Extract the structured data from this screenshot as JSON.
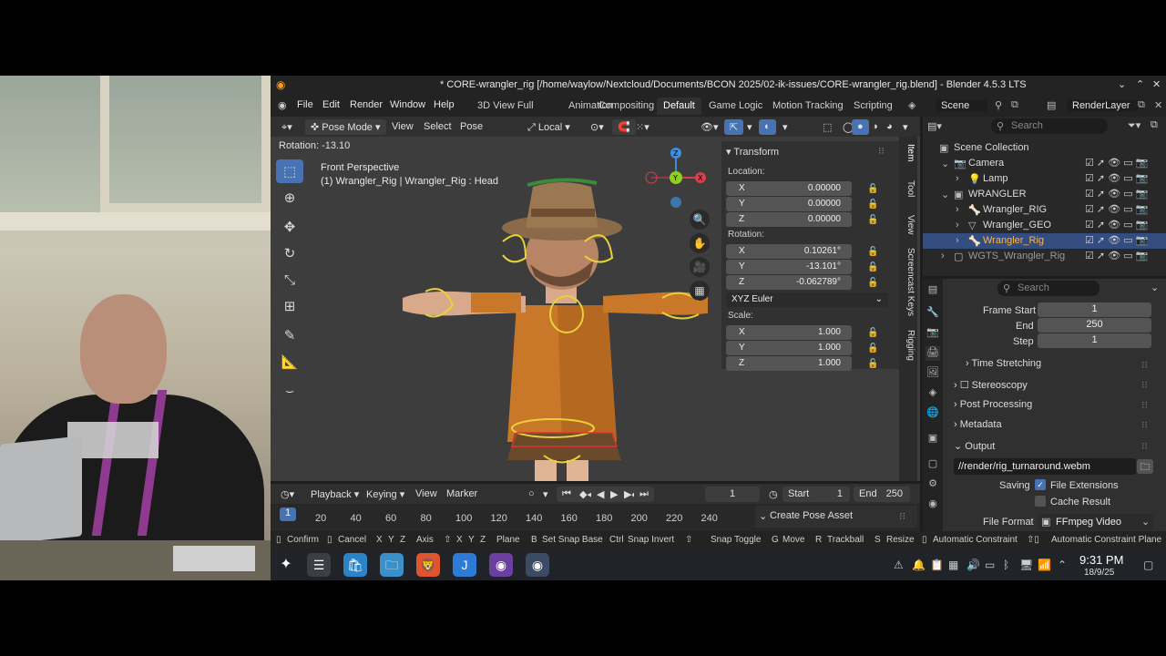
{
  "titlebar": {
    "title": "* CORE-wrangler_rig [/home/waylow/Nextcloud/Documents/BCON 2025/02-ik-issues/CORE-wrangler_rig.blend] - Blender 4.5.3 LTS"
  },
  "menu": [
    "File",
    "Edit",
    "Render",
    "Window",
    "Help"
  ],
  "workspaces": [
    "3D View Full",
    "Animation",
    "Compositing",
    "Default",
    "Game Logic",
    "Motion Tracking",
    "Scripting"
  ],
  "active_workspace": "Default",
  "scene": {
    "label": "Scene",
    "render_layer": "RenderLayer"
  },
  "viewport_header": {
    "mode": "Pose Mode",
    "items": [
      "View",
      "Select",
      "Pose"
    ],
    "orientation": "Local"
  },
  "viewport": {
    "operator_status": "Rotation: -13.10",
    "perspective": "Front Perspective",
    "object_info": "(1) Wrangler_Rig | Wrangler_Rig : Head"
  },
  "npanel": {
    "tabs": [
      "Item",
      "Tool",
      "View",
      "Screencast Keys",
      "Rigging"
    ],
    "section": "Transform",
    "location_label": "Location:",
    "location": [
      {
        "axis": "X",
        "value": "0.00000"
      },
      {
        "axis": "Y",
        "value": "0.00000"
      },
      {
        "axis": "Z",
        "value": "0.00000"
      }
    ],
    "rotation_label": "Rotation:",
    "rotation": [
      {
        "axis": "X",
        "value": "0.10261°"
      },
      {
        "axis": "Y",
        "value": "-13.101°"
      },
      {
        "axis": "Z",
        "value": "-0.062789°"
      }
    ],
    "rotation_mode": "XYZ Euler",
    "scale_label": "Scale:",
    "scale": [
      {
        "axis": "X",
        "value": "1.000"
      },
      {
        "axis": "Y",
        "value": "1.000"
      },
      {
        "axis": "Z",
        "value": "1.000"
      }
    ]
  },
  "timeline": {
    "menus": [
      "Playback",
      "Keying",
      "View",
      "Marker"
    ],
    "current_frame": "1",
    "start_label": "Start",
    "start": "1",
    "end_label": "End",
    "end": "250",
    "frame_marks": [
      "20",
      "40",
      "60",
      "80",
      "100",
      "120",
      "140",
      "160",
      "180",
      "200",
      "220",
      "240"
    ],
    "cursor": "1",
    "create_pose_asset": "Create Pose Asset"
  },
  "statusbar": {
    "items": [
      "Confirm",
      "Cancel",
      "Axis",
      "Plane",
      "Set Snap Base",
      "Snap Invert",
      "Snap Toggle",
      "Move",
      "Trackball",
      "Resize",
      "Automatic Constraint",
      "Automatic Constraint Plane"
    ],
    "keys": [
      "X",
      "Y",
      "Z",
      "X",
      "Y",
      "Z",
      "B",
      "Ctrl",
      "G",
      "R",
      "S"
    ]
  },
  "outliner": {
    "search_placeholder": "Search",
    "rows": [
      {
        "label": "Scene Collection",
        "indent": 0
      },
      {
        "label": "Camera",
        "indent": 1
      },
      {
        "label": "Lamp",
        "indent": 2
      },
      {
        "label": "WRANGLER",
        "indent": 1
      },
      {
        "label": "Wrangler_RIG",
        "indent": 2
      },
      {
        "label": "Wrangler_GEO",
        "indent": 2
      },
      {
        "label": "Wrangler_Rig",
        "indent": 2,
        "selected": true
      },
      {
        "label": "WGTS_Wrangler_Rig",
        "indent": 1
      }
    ]
  },
  "properties": {
    "search_placeholder": "Search",
    "frame_start_label": "Frame Start",
    "frame_start": "1",
    "end_label": "End",
    "end": "250",
    "step_label": "Step",
    "step": "1",
    "sections": [
      "Time Stretching",
      "Stereoscopy",
      "Post Processing",
      "Metadata",
      "Output"
    ],
    "output_path": "//render/rig_turnaround.webm",
    "saving_label": "Saving",
    "file_extensions": "File Extensions",
    "cache_result": "Cache Result",
    "file_format_label": "File Format",
    "file_format": "FFmpeg Video"
  },
  "taskbar": {
    "time": "9:31 PM",
    "date": "18/9/25"
  },
  "colors": {
    "accent": "#4772b3",
    "selection": "#334d80",
    "axis_x": "#d83e4b",
    "axis_y": "#8ecf1f",
    "axis_z": "#3b8fdc"
  }
}
